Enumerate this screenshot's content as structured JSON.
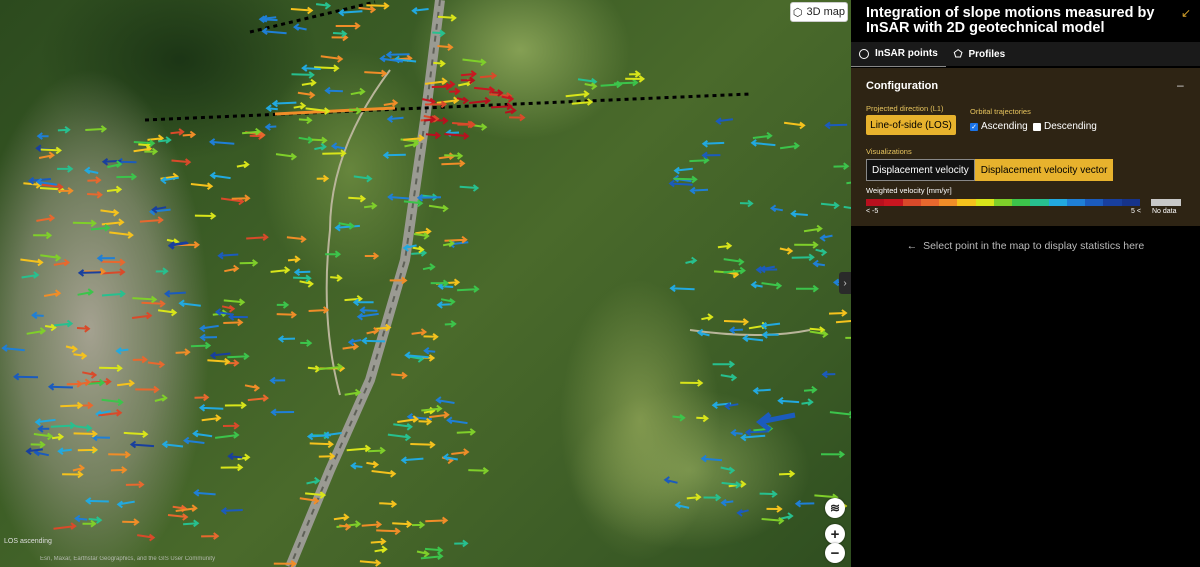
{
  "map": {
    "btn_3d": "3D map",
    "attribution": "LOS ascending",
    "attribution_small": "Esri, Maxar, Earthstar Geographics, and the GIS User Community"
  },
  "panel": {
    "title": "Integration of slope motions measured by InSAR with 2D geotechnical model",
    "tabs": [
      {
        "label": "InSAR points",
        "icon": "circle-icon",
        "active": true
      },
      {
        "label": "Profiles",
        "icon": "pentagon-icon",
        "active": false
      }
    ],
    "config": {
      "title": "Configuration",
      "minimize": "–",
      "projected_label": "Projected direction (L1)",
      "los_button": "Line-of-side (LOS)",
      "orbital_label": "Orbital trajectories",
      "ascending": {
        "label": "Ascending",
        "checked": true
      },
      "descending": {
        "label": "Descending",
        "checked": false
      },
      "visualizations_label": "Visualizations",
      "vis_options": [
        "Displacement velocity",
        "Displacement velocity vector"
      ],
      "vis_selected": "Displacement velocity vector",
      "weighted_label": "Weighted velocity [mm/yr]",
      "ramp_min": "< -5",
      "ramp_max": "5 <",
      "no_data": "No data",
      "ramp_colors": [
        "#b8101e",
        "#c91620",
        "#d94a2a",
        "#e8682e",
        "#f08d28",
        "#f5c21d",
        "#d9e51a",
        "#7fcf2a",
        "#3cc44b",
        "#27c08f",
        "#22a9e0",
        "#1f7fd6",
        "#1b5bbd",
        "#183f9e",
        "#16338a"
      ]
    },
    "hint": "Select point in the map to display statistics here"
  },
  "colors": {
    "accent": "#e7b22d",
    "panel_bg": "#000000",
    "config_bg": "#2e2414"
  }
}
